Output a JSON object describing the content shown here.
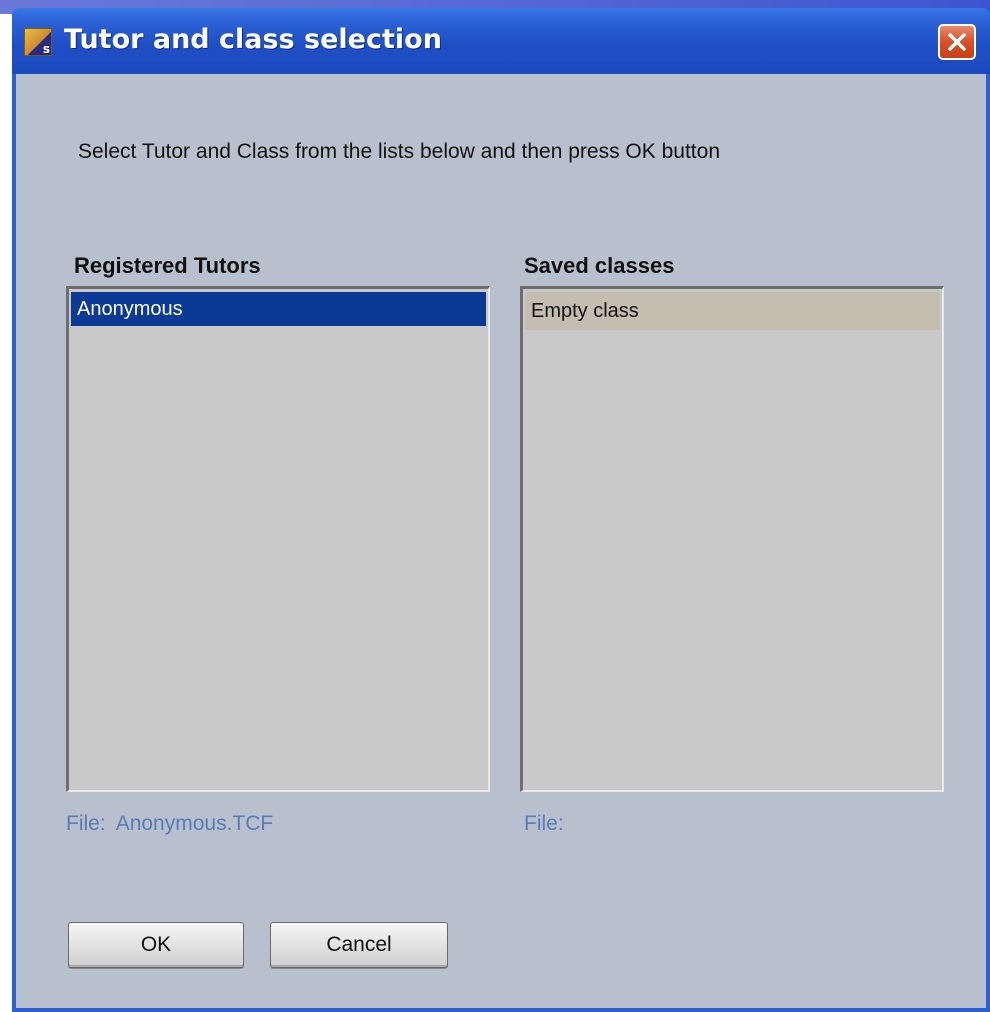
{
  "window": {
    "title": "Tutor and class selection",
    "icon": "app-icon",
    "icon_badge": "s",
    "close_icon": "close-icon"
  },
  "instruction": "Select Tutor and Class from the lists below and then press OK button",
  "tutors": {
    "label": "Registered Tutors",
    "items": [
      "Anonymous"
    ],
    "selected": "Anonymous",
    "file_prefix": "File:",
    "file_value": "Anonymous.TCF"
  },
  "classes": {
    "label": "Saved classes",
    "items": [
      "Empty class"
    ],
    "selected": "Empty class",
    "file_prefix": "File:",
    "file_value": ""
  },
  "buttons": {
    "ok": "OK",
    "cancel": "Cancel"
  },
  "colors": {
    "titlebar": "#2d63d8",
    "client_bg": "#b7c0cc",
    "selection_active": "#0a3a96",
    "selection_inactive": "#c4beb0",
    "file_text": "#5a7ab8",
    "close_button": "#d8502a"
  }
}
